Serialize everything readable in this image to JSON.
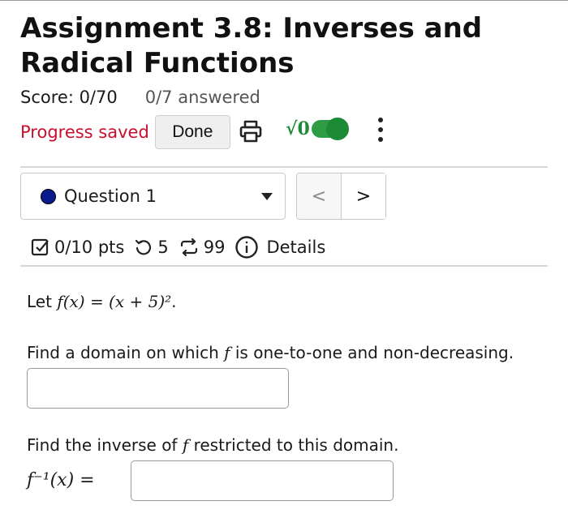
{
  "assignment": {
    "title": "Assignment 3.8: Inverses and Radical Functions",
    "score": "Score: 0/70",
    "answered": "0/7 answered"
  },
  "toolbar": {
    "progress_saved": "Progress saved",
    "done_label": "Done",
    "print_icon": "printer-icon",
    "math_toggle_label": "√0",
    "math_toggle_on": true,
    "more_icon": "vertical-ellipsis-icon"
  },
  "question_nav": {
    "selected_question": "Question 1",
    "prev_label": "<",
    "next_label": ">"
  },
  "question_meta": {
    "points": "0/10 pts",
    "attempts": "5",
    "retries": "99",
    "details_label": "Details"
  },
  "question": {
    "intro_prefix": "Let ",
    "function_def": "f(x) = (x + 5)²",
    "intro_suffix": ".",
    "part1_prefix": "Find a domain on which ",
    "part1_var": "f",
    "part1_suffix": " is one-to-one and non-decreasing.",
    "part1_answer": "",
    "part2_prefix": "Find the inverse of ",
    "part2_var": "f",
    "part2_suffix": " restricted to this domain.",
    "part2_lhs": "f⁻¹(x) =",
    "part2_answer": ""
  },
  "colors": {
    "progress_saved": "#c8102e",
    "toggle_green": "#2e9b45",
    "question_dot": "#0b1a8c"
  }
}
